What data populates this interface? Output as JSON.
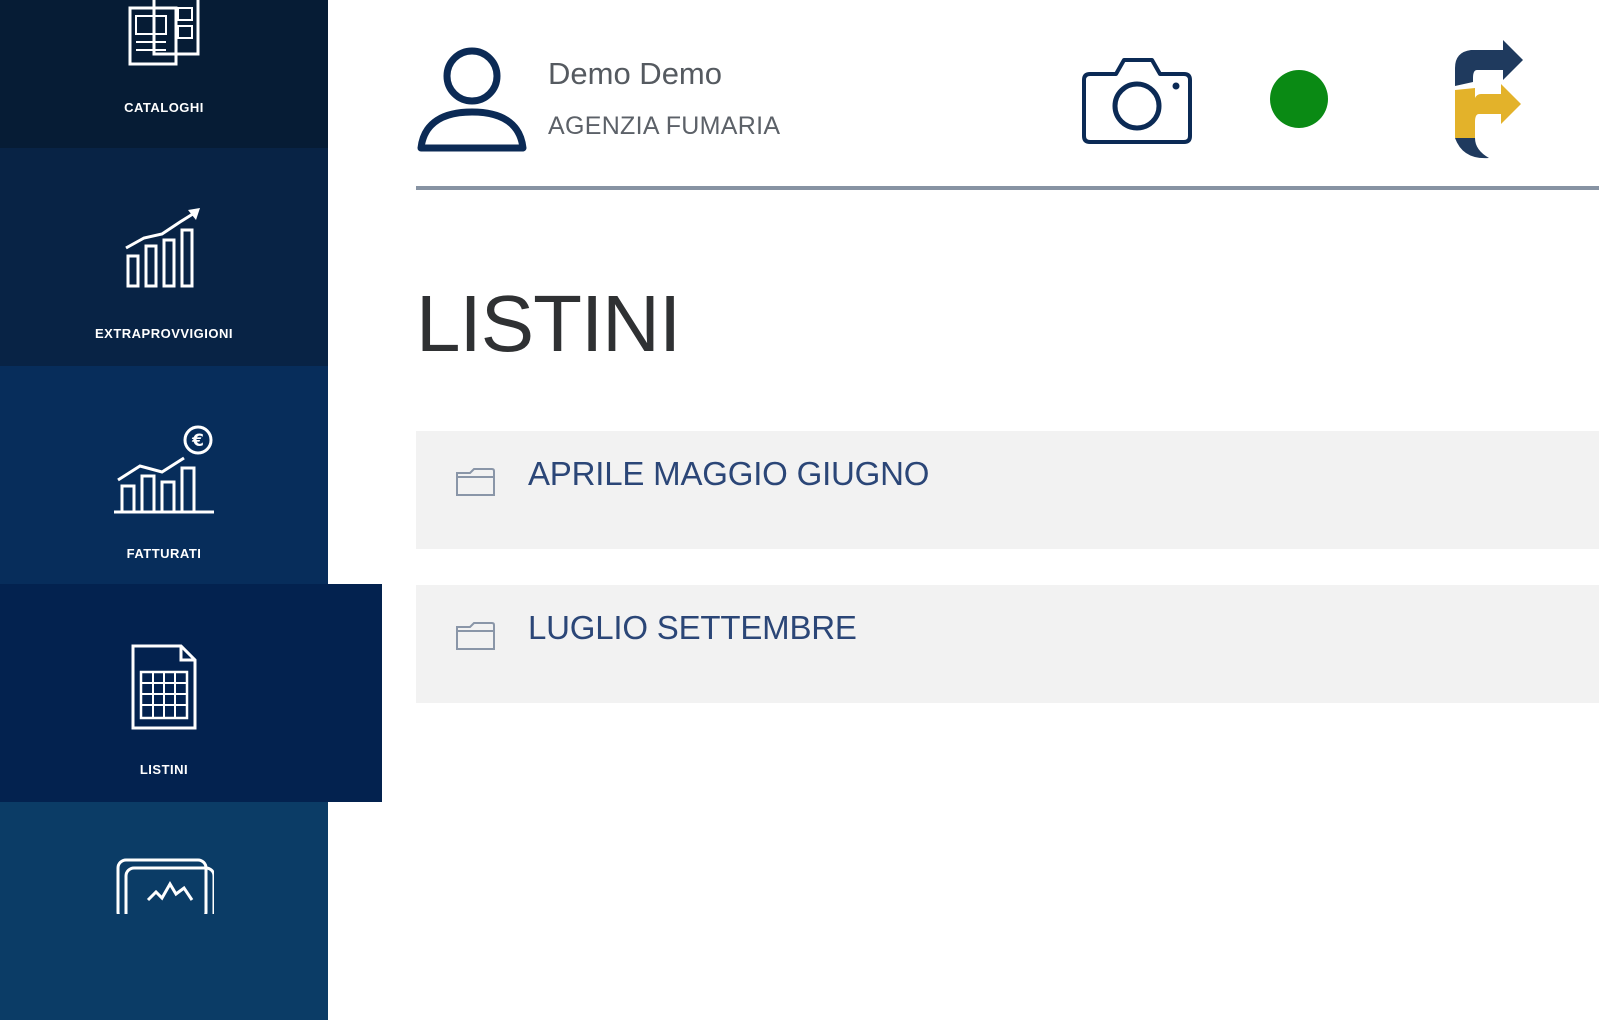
{
  "sidebar": {
    "items": [
      {
        "label": "CATALOGHI",
        "icon": "catalog-icon",
        "color": "#061c35",
        "active": false
      },
      {
        "label": "EXTRAPROVVIGIONI",
        "icon": "growth-chart-icon",
        "color": "#082345",
        "active": false
      },
      {
        "label": "FATTURATI",
        "icon": "revenue-chart-icon",
        "color": "#072d5b",
        "active": false
      },
      {
        "label": "LISTINI",
        "icon": "spreadsheet-icon",
        "color": "#03224f",
        "active": true
      },
      {
        "label": "",
        "icon": "dashboard-icon",
        "color": "#0b3c66",
        "active": false
      }
    ]
  },
  "header": {
    "user_name": "Demo Demo",
    "user_org": "AGENZIA FUMARIA",
    "status_color": "#0a8a14",
    "icons": [
      "user-icon",
      "camera-icon",
      "status-dot",
      "brand-logo"
    ]
  },
  "main": {
    "title": "LISTINI",
    "folders": [
      {
        "label": "APRILE MAGGIO GIUGNO",
        "icon": "folder-icon"
      },
      {
        "label": "LUGLIO SETTEMBRE",
        "icon": "folder-icon"
      }
    ]
  },
  "colors": {
    "accent_text": "#2b4677",
    "logo_navy": "#1f3a5e",
    "logo_gold": "#e3b22a"
  }
}
